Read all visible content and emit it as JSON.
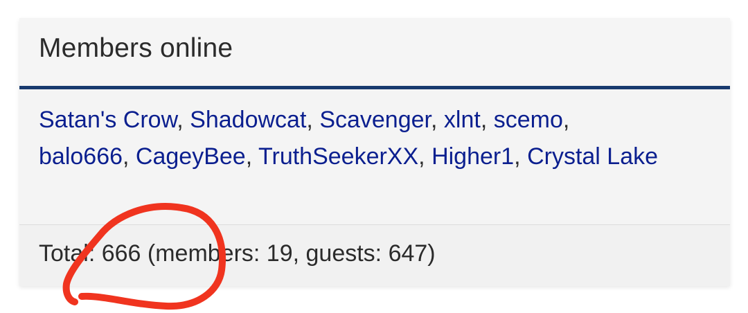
{
  "widget": {
    "title": "Members online",
    "members": [
      "Satan's Crow",
      "Shadowcat",
      "Scavenger",
      "xlnt",
      "scemo",
      "balo666",
      "CageyBee",
      "TruthSeekerXX",
      "Higher1",
      "Crystal Lake"
    ],
    "separator": ", ",
    "total_text": "Total: 666 (members: 19, guests: 647)"
  },
  "colors": {
    "link": "#0b1f8f",
    "header_border": "#183a6e",
    "annotation_stroke": "#f0341f"
  }
}
